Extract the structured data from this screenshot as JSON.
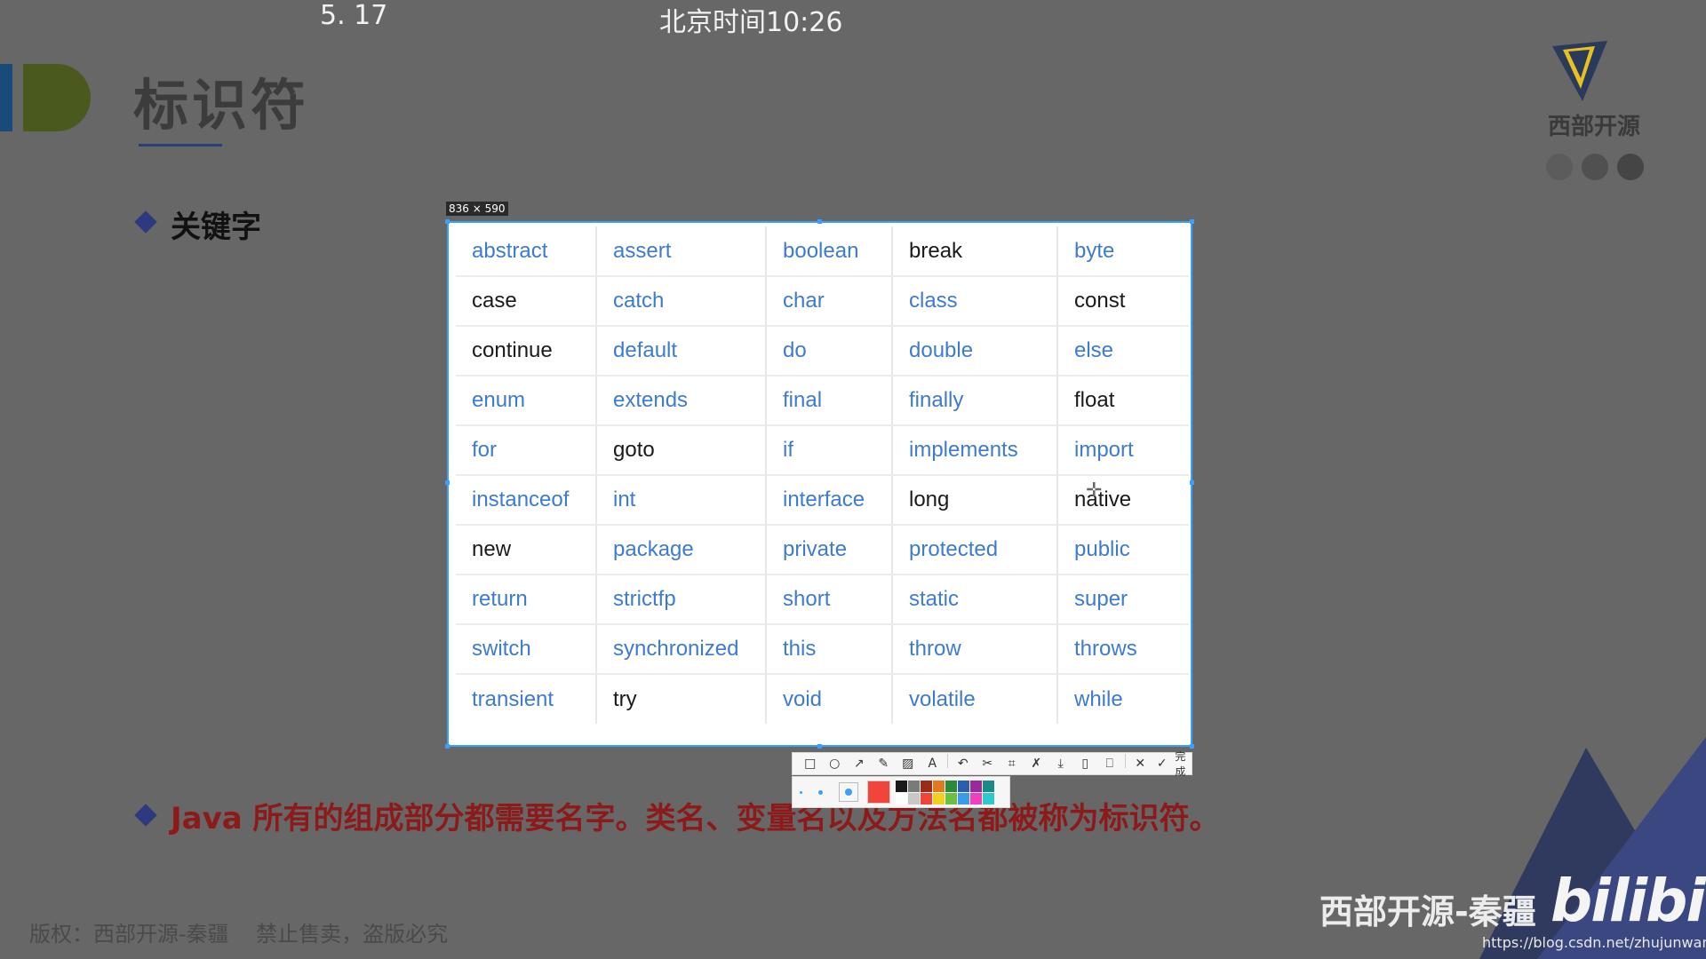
{
  "top_bar": {
    "left_text": "5. 17",
    "center_text": "北京时间10:26"
  },
  "slide": {
    "title": "标识符",
    "keyword_heading": "关键字",
    "statement": "Java 所有的组成部分都需要名字。类名、变量名以及方法名都被称为标识符。"
  },
  "logo": {
    "text": "西部开源"
  },
  "footer": {
    "copyright": "版权：西部开源-秦疆    禁止售卖，盗版必究",
    "watermark": "西部开源-秦疆",
    "bili_logo": "bilibili",
    "url": "https://blog.csdn.net/zhujunwansui"
  },
  "capture": {
    "size_label": "836 × 590",
    "keywords": [
      [
        {
          "t": "abstract",
          "c": "blue"
        },
        {
          "t": "assert",
          "c": "blue"
        },
        {
          "t": "boolean",
          "c": "blue"
        },
        {
          "t": "break",
          "c": "black"
        },
        {
          "t": "byte",
          "c": "blue"
        }
      ],
      [
        {
          "t": "case",
          "c": "black"
        },
        {
          "t": "catch",
          "c": "blue"
        },
        {
          "t": "char",
          "c": "blue"
        },
        {
          "t": "class",
          "c": "blue"
        },
        {
          "t": "const",
          "c": "black"
        }
      ],
      [
        {
          "t": "continue",
          "c": "black"
        },
        {
          "t": "default",
          "c": "blue"
        },
        {
          "t": "do",
          "c": "blue"
        },
        {
          "t": "double",
          "c": "blue"
        },
        {
          "t": "else",
          "c": "blue"
        }
      ],
      [
        {
          "t": "enum",
          "c": "blue"
        },
        {
          "t": "extends",
          "c": "blue"
        },
        {
          "t": "final",
          "c": "blue"
        },
        {
          "t": "finally",
          "c": "blue"
        },
        {
          "t": "float",
          "c": "black"
        }
      ],
      [
        {
          "t": "for",
          "c": "blue"
        },
        {
          "t": "goto",
          "c": "black"
        },
        {
          "t": "if",
          "c": "blue"
        },
        {
          "t": "implements",
          "c": "blue"
        },
        {
          "t": "import",
          "c": "blue"
        }
      ],
      [
        {
          "t": "instanceof",
          "c": "blue"
        },
        {
          "t": "int",
          "c": "blue"
        },
        {
          "t": "interface",
          "c": "blue"
        },
        {
          "t": "long",
          "c": "black"
        },
        {
          "t": "native",
          "c": "black"
        }
      ],
      [
        {
          "t": "new",
          "c": "black"
        },
        {
          "t": "package",
          "c": "blue"
        },
        {
          "t": "private",
          "c": "blue"
        },
        {
          "t": "protected",
          "c": "blue"
        },
        {
          "t": "public",
          "c": "blue"
        }
      ],
      [
        {
          "t": "return",
          "c": "blue"
        },
        {
          "t": "strictfp",
          "c": "blue"
        },
        {
          "t": "short",
          "c": "blue"
        },
        {
          "t": "static",
          "c": "blue"
        },
        {
          "t": "super",
          "c": "blue"
        }
      ],
      [
        {
          "t": "switch",
          "c": "blue"
        },
        {
          "t": "synchronized",
          "c": "blue"
        },
        {
          "t": "this",
          "c": "blue"
        },
        {
          "t": "throw",
          "c": "blue"
        },
        {
          "t": "throws",
          "c": "blue"
        }
      ],
      [
        {
          "t": "transient",
          "c": "blue"
        },
        {
          "t": "try",
          "c": "black"
        },
        {
          "t": "void",
          "c": "blue"
        },
        {
          "t": "volatile",
          "c": "blue"
        },
        {
          "t": "while",
          "c": "blue"
        }
      ]
    ],
    "toolbar": {
      "tools": [
        {
          "name": "rectangle-tool-icon",
          "glyph": "□"
        },
        {
          "name": "ellipse-tool-icon",
          "glyph": "○"
        },
        {
          "name": "arrow-tool-icon",
          "glyph": "↗"
        },
        {
          "name": "pen-tool-icon",
          "glyph": "✎"
        },
        {
          "name": "mosaic-tool-icon",
          "glyph": "▨"
        },
        {
          "name": "text-tool-icon",
          "glyph": "A"
        },
        {
          "name": "undo-icon",
          "glyph": "↶"
        },
        {
          "name": "scissors-icon",
          "glyph": "✂"
        },
        {
          "name": "crop-icon",
          "glyph": "⌗"
        },
        {
          "name": "pin-icon",
          "glyph": "✗"
        },
        {
          "name": "download-icon",
          "glyph": "⤓"
        },
        {
          "name": "save-icon",
          "glyph": "▯"
        },
        {
          "name": "bookmark-icon",
          "glyph": "⎕"
        },
        {
          "name": "close-icon",
          "glyph": "✕"
        }
      ],
      "done_label": "完成"
    },
    "palette": {
      "current_color": "#f0453a",
      "swatches": [
        "#1a1a1a",
        "#7a7a7a",
        "#9c2a1a",
        "#e07a20",
        "#2a8a3a",
        "#2a5fb0",
        "#9a2a9a",
        "#1a8a8a",
        "#ffffff",
        "#c8c8c8",
        "#f0453a",
        "#f0d020",
        "#6ac040",
        "#3a9af0",
        "#f040c0",
        "#30c8d0"
      ]
    }
  },
  "colors": {
    "background": "#676767",
    "selection_border": "#3aa0ff",
    "keyword_blue": "#3d7bd3",
    "statement_red": "#8c1a1a"
  }
}
